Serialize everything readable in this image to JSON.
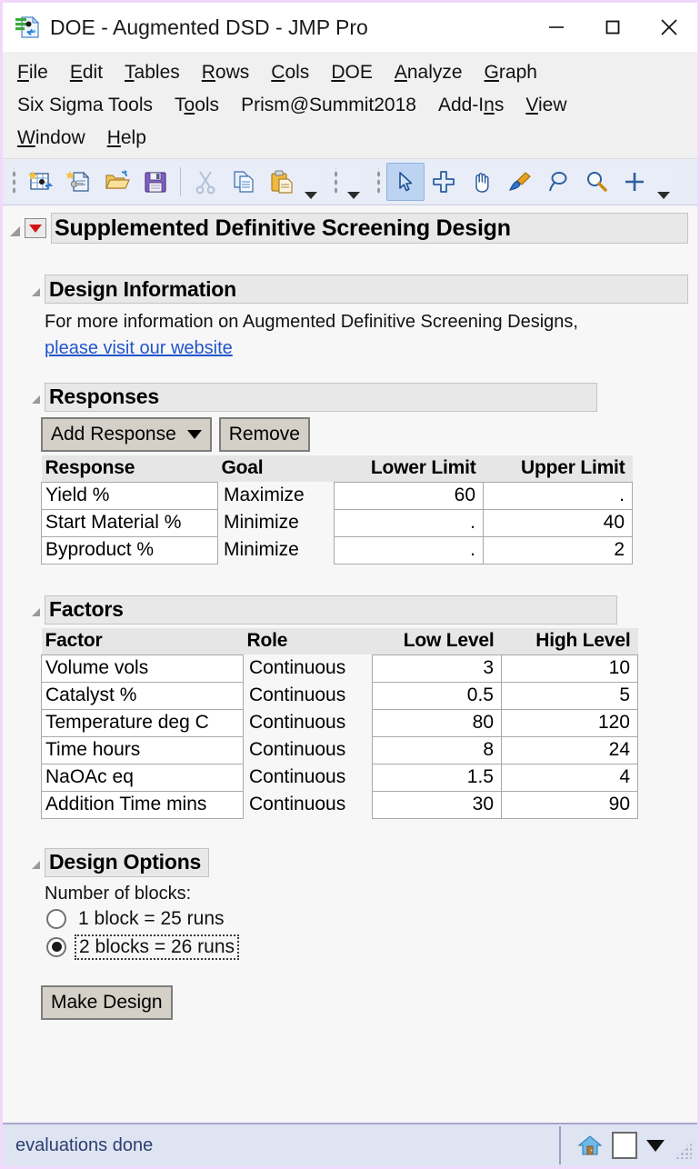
{
  "window": {
    "title": "DOE - Augmented DSD - JMP Pro",
    "app_icon": "doe-document-icon",
    "minimize_label": "Minimize",
    "maximize_label": "Maximize",
    "close_label": "Close"
  },
  "menubar": {
    "rows": [
      [
        {
          "label": "File",
          "accel": "F"
        },
        {
          "label": "Edit",
          "accel": "E"
        },
        {
          "label": "Tables",
          "accel": "T"
        },
        {
          "label": "Rows",
          "accel": "R"
        },
        {
          "label": "Cols",
          "accel": "C"
        },
        {
          "label": "DOE",
          "accel": "D"
        },
        {
          "label": "Analyze",
          "accel": "A"
        },
        {
          "label": "Graph",
          "accel": "G"
        }
      ],
      [
        {
          "label": "Six Sigma Tools",
          "accel": ""
        },
        {
          "label": "Tools",
          "accel": "o"
        },
        {
          "label": "Prism@Summit2018",
          "accel": ""
        },
        {
          "label": "Add-Ins",
          "accel": "n"
        },
        {
          "label": "View",
          "accel": "V"
        }
      ],
      [
        {
          "label": "Window",
          "accel": "W"
        },
        {
          "label": "Help",
          "accel": "H"
        }
      ]
    ]
  },
  "toolbar": {
    "group1": [
      "new-data-table-icon",
      "new-script-icon",
      "open-file-icon",
      "save-file-icon",
      "separator",
      "cut-icon",
      "copy-icon",
      "paste-icon"
    ],
    "group2": [],
    "group3": [
      "arrow-select-icon",
      "crosshair-icon",
      "hand-pan-icon",
      "brush-icon",
      "lasso-icon",
      "magnifier-zoom-icon",
      "annotate-plus-icon"
    ],
    "overflow_label": "More toolbar buttons"
  },
  "report": {
    "top_title": "Supplemented Definitive Screening Design",
    "red_triangle_label": "Supplemented Definitive Screening Design menu",
    "design_information": {
      "title": "Design Information",
      "paragraph": "For more information on Augmented Definitive Screening Designs,",
      "link": "please visit our website"
    },
    "responses": {
      "title": "Responses",
      "add_button": "Add Response",
      "remove_button": "Remove",
      "columns": [
        "Response",
        "Goal",
        "Lower Limit",
        "Upper Limit"
      ],
      "rows": [
        {
          "response": "Yield %",
          "goal": "Maximize",
          "lower": "60",
          "upper": "."
        },
        {
          "response": "Start Material %",
          "goal": "Minimize",
          "lower": ".",
          "upper": "40"
        },
        {
          "response": "Byproduct %",
          "goal": "Minimize",
          "lower": ".",
          "upper": "2"
        }
      ]
    },
    "factors": {
      "title": "Factors",
      "columns": [
        "Factor",
        "Role",
        "Low Level",
        "High Level"
      ],
      "rows": [
        {
          "factor": "Volume vols",
          "role": "Continuous",
          "low": "3",
          "high": "10"
        },
        {
          "factor": "Catalyst %",
          "role": "Continuous",
          "low": "0.5",
          "high": "5"
        },
        {
          "factor": "Temperature deg C",
          "role": "Continuous",
          "low": "80",
          "high": "120"
        },
        {
          "factor": "Time hours",
          "role": "Continuous",
          "low": "8",
          "high": "24"
        },
        {
          "factor": "NaOAc eq",
          "role": "Continuous",
          "low": "1.5",
          "high": "4"
        },
        {
          "factor": "Addition Time mins",
          "role": "Continuous",
          "low": "30",
          "high": "90"
        }
      ]
    },
    "design_options": {
      "title": "Design Options",
      "blocks_label": "Number of blocks:",
      "options": [
        {
          "label": "1 block = 25 runs",
          "selected": false
        },
        {
          "label": "2 blocks = 26 runs",
          "selected": true
        }
      ],
      "make_design_button": "Make Design"
    }
  },
  "statusbar": {
    "message": "evaluations done",
    "home_icon": "home-icon",
    "square_button_label": "status square button",
    "dropdown_label": "status dropdown"
  },
  "colors": {
    "window_border": "#f2d9fb",
    "menubar_bg": "#f1f0f0",
    "toolbar_bg": "#e8ecf7",
    "report_bg": "#f7f7f7",
    "section_header_bg": "#e8e8e8",
    "table_header_bg": "#e6e6e6",
    "link": "#2255cc",
    "red_triangle": "#d41414",
    "status_bg": "#dfe4f2",
    "status_text": "#2b3f70",
    "button_face": "#d4d0c8",
    "selected_tool": "#bcd4f2"
  }
}
